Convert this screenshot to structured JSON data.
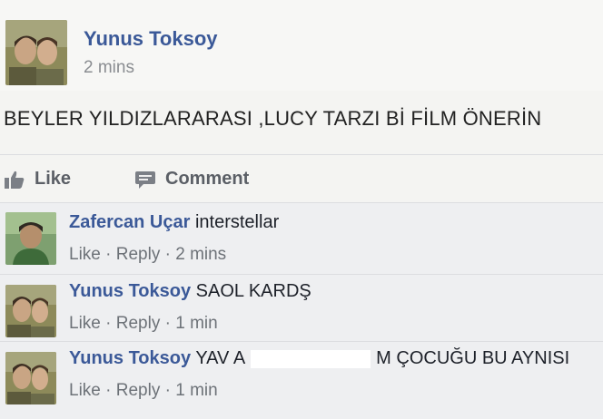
{
  "post": {
    "author": "Yunus Toksoy",
    "time": "2 mins",
    "text": "BEYLER YILDIZLARARASI ,LUCY TARZI Bİ FİLM ÖNERİN"
  },
  "actions": {
    "like": "Like",
    "comment": "Comment"
  },
  "comments": [
    {
      "name": "Zafercan Uçar",
      "text": "interstellar",
      "like": "Like",
      "reply": "Reply",
      "sep": "·",
      "time": "2 mins"
    },
    {
      "name": "Yunus Toksoy",
      "text": "SAOL KARDŞ",
      "like": "Like",
      "reply": "Reply",
      "sep": "·",
      "time": "1 min"
    },
    {
      "name": "Yunus Toksoy",
      "text_start": "YAV A",
      "text_end": "M ÇOCUĞU BU AYNISI",
      "like": "Like",
      "reply": "Reply",
      "sep": "·",
      "time": "1 min"
    }
  ],
  "icons": {
    "like": "thumbs-up-icon",
    "comment": "speech-bubble-icon"
  }
}
